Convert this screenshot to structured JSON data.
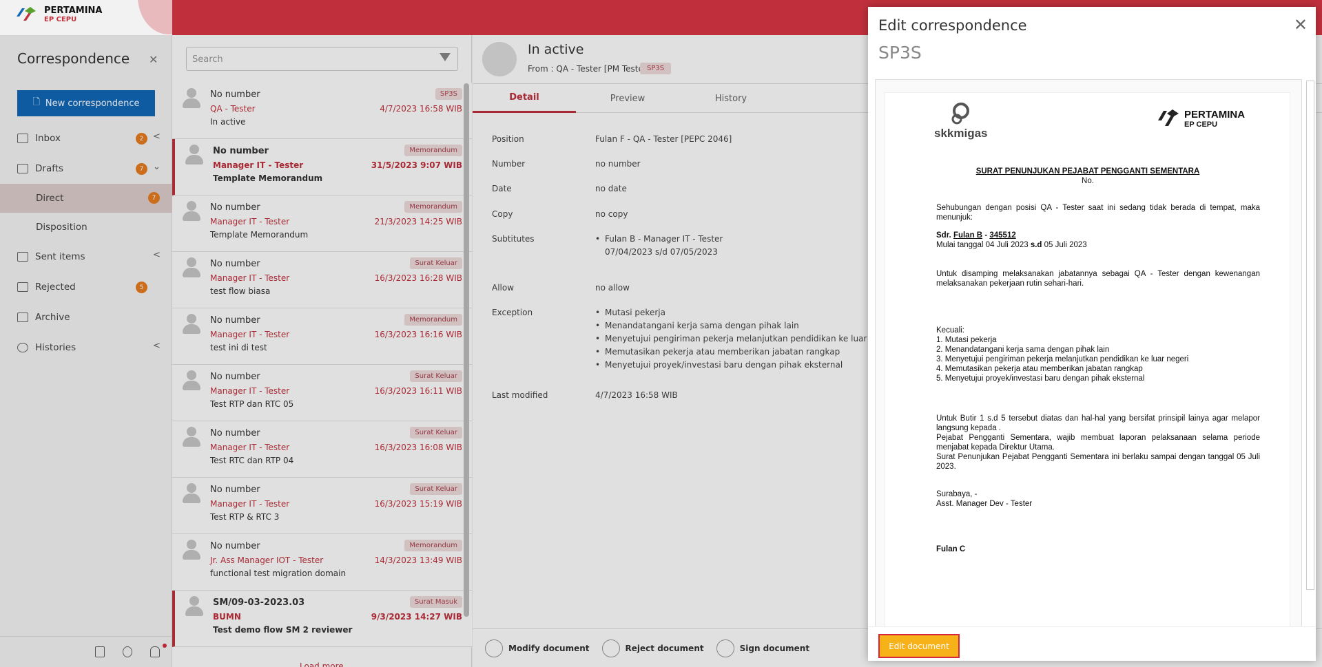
{
  "brand": {
    "name": "PERTAMINA",
    "sub": "EP CEPU"
  },
  "sidebar": {
    "title": "Correspondence",
    "new_button": "New correspondence",
    "items": [
      {
        "label": "Inbox",
        "badge": "2"
      },
      {
        "label": "Drafts",
        "badge": "7"
      },
      {
        "label": "Direct",
        "badge": "7"
      },
      {
        "label": "Disposition"
      },
      {
        "label": "Sent items"
      },
      {
        "label": "Rejected",
        "badge": "5"
      },
      {
        "label": "Archive"
      },
      {
        "label": "Histories"
      }
    ]
  },
  "list": {
    "search_placeholder": "Search",
    "load_more": "Load more",
    "items": [
      {
        "number": "No number",
        "from": "QA - Tester",
        "subject": "In active",
        "tag": "SP3S",
        "date": "4/7/2023 16:58 WIB"
      },
      {
        "number": "No number",
        "from": "Manager IT - Tester",
        "subject": "Template Memorandum",
        "tag": "Memorandum",
        "date": "31/5/2023 9:07 WIB"
      },
      {
        "number": "No number",
        "from": "Manager IT - Tester",
        "subject": "Template Memorandum",
        "tag": "Memorandum",
        "date": "21/3/2023 14:25 WIB"
      },
      {
        "number": "No number",
        "from": "Manager IT - Tester",
        "subject": "test flow biasa",
        "tag": "Surat Keluar",
        "date": "16/3/2023 16:28 WIB"
      },
      {
        "number": "No number",
        "from": "Manager IT - Tester",
        "subject": "test ini di test",
        "tag": "Memorandum",
        "date": "16/3/2023 16:16 WIB"
      },
      {
        "number": "No number",
        "from": "Manager IT - Tester",
        "subject": "Test RTP dan RTC 05",
        "tag": "Surat Keluar",
        "date": "16/3/2023 16:11 WIB"
      },
      {
        "number": "No number",
        "from": "Manager IT - Tester",
        "subject": "Test RTC dan RTP 04",
        "tag": "Surat Keluar",
        "date": "16/3/2023 16:08 WIB"
      },
      {
        "number": "No number",
        "from": "Manager IT - Tester",
        "subject": "Test RTP & RTC 3",
        "tag": "Surat Keluar",
        "date": "16/3/2023 15:19 WIB"
      },
      {
        "number": "No number",
        "from": "Jr. Ass Manager IOT - Tester",
        "subject": "functional test migration domain",
        "tag": "Memorandum",
        "date": "14/3/2023 13:49 WIB"
      },
      {
        "number": "SM/09-03-2023.03",
        "from": "BUMN",
        "subject": "Test demo flow SM 2 reviewer",
        "tag": "Surat Masuk",
        "date": "9/3/2023 14:27 WIB"
      }
    ]
  },
  "detail": {
    "title": "In active",
    "from": "From : QA - Tester [PM Tester]",
    "tag": "SP3S",
    "tabs": [
      "Detail",
      "Preview",
      "History"
    ],
    "fields": {
      "position_k": "Position",
      "position_v": "Fulan F - QA - Tester [PEPC 2046]",
      "number_k": "Number",
      "number_v": "no number",
      "date_k": "Date",
      "date_v": "no date",
      "copy_k": "Copy",
      "copy_v": "no copy",
      "subs_k": "Subtitutes",
      "subs_1": "Fulan B - Manager IT - Tester",
      "subs_2": "07/04/2023 s/d 07/05/2023",
      "allow_k": "Allow",
      "allow_v": "no allow",
      "exc_k": "Exception",
      "exc": [
        "Mutasi pekerja",
        "Menandatangani kerja sama dengan pihak lain",
        "Menyetujui pengiriman pekerja melanjutkan pendidikan ke luar negeri",
        "Memutasikan pekerja atau memberikan jabatan rangkap",
        "Menyetujui proyek/investasi baru dengan pihak eksternal"
      ],
      "mod_k": "Last modified",
      "mod_v": "4/7/2023 16:58 WIB"
    },
    "actions": [
      "Modify document",
      "Reject document",
      "Sign document"
    ]
  },
  "modal": {
    "title": "Edit correspondence",
    "subtitle": "SP3S",
    "button": "Edit document",
    "doc": {
      "logo_left": "skkmigas",
      "logo_right": "PERTAMINA",
      "logo_right_sub": "EP CEPU",
      "heading": "SURAT PENUNJUKAN PEJABAT PENGGANTI SEMENTARA",
      "no": "No.",
      "p1": "Sehubungan dengan posisi QA - Tester saat ini sedang tidak berada di tempat, maka menunjuk:",
      "sdr_label": "Sdr.",
      "sdr_name": "Fulan B",
      "sdr_sep": "-",
      "sdr_id": "345512",
      "mulai_pre": "Mulai tanggal 04 Juli 2023",
      "mulai_sd": "s.d",
      "mulai_post": "05 Juli 2023",
      "p2": "Untuk disamping melaksanakan jabatannya sebagai QA - Tester dengan kewenangan melaksanakan pekerjaan rutin sehari-hari.",
      "kecuali": "Kecuali:",
      "exc": [
        "1. Mutasi pekerja",
        "2. Menandatangani  kerja sama dengan pihak lain",
        "3. Menyetujui  pengiriman pekerja melanjutkan  pendidikan ke luar negeri",
        "4. Memutasikan pekerja atau memberikan jabatan rangkap",
        "5. Menyetujui  proyek/investasi  baru dengan pihak eksternal"
      ],
      "p3": "Untuk Butir 1 s.d 5 tersebut diatas dan hal-hal yang bersifat prinsipil lainya agar melapor langsung kepada .",
      "p4": "Pejabat Pengganti Sementara, wajib membuat laporan pelaksanaan selama periode menjabat kepada Direktur Utama.",
      "p5": "Surat Penunjukan Pejabat Pengganti Sementara ini berlaku sampai dengan tanggal 05 Juli 2023.",
      "place": "Surabaya, -",
      "signer_title": "Asst. Manager Dev - Tester",
      "signer": "Fulan C"
    }
  },
  "colors": {
    "brand_red": "#c0303c",
    "primary_blue": "#1068b8",
    "badge_orange": "#e87d1f",
    "edit_yellow": "#f7b21a"
  }
}
